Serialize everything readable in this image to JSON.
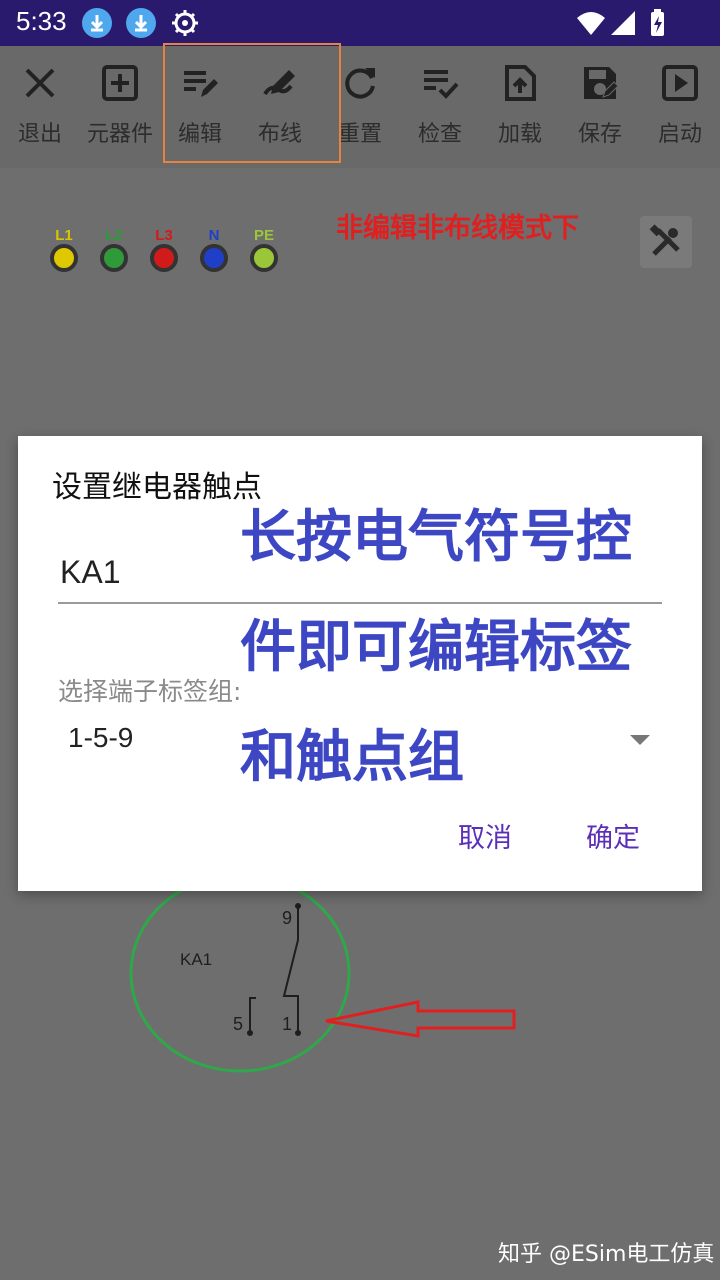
{
  "status_bar": {
    "time": "5:33",
    "icons": [
      "download-icon",
      "download-icon",
      "settings-icon",
      "wifi-icon",
      "signal-icon",
      "battery-charging-icon"
    ]
  },
  "toolbar": {
    "items": [
      {
        "name": "exit",
        "label": "退出",
        "icon": "close-icon"
      },
      {
        "name": "components",
        "label": "元器件",
        "icon": "add-box-icon"
      },
      {
        "name": "edit",
        "label": "编辑",
        "icon": "edit-list-icon"
      },
      {
        "name": "wiring",
        "label": "布线",
        "icon": "pen-draw-icon"
      },
      {
        "name": "reset",
        "label": "重置",
        "icon": "refresh-icon"
      },
      {
        "name": "check",
        "label": "检查",
        "icon": "checklist-icon"
      },
      {
        "name": "load",
        "label": "加载",
        "icon": "file-upload-icon"
      },
      {
        "name": "save",
        "label": "保存",
        "icon": "save-icon"
      },
      {
        "name": "start",
        "label": "启动",
        "icon": "play-box-icon"
      }
    ]
  },
  "terminals": [
    {
      "label": "L1",
      "color": "#e0c800"
    },
    {
      "label": "L2",
      "color": "#2e9a3a"
    },
    {
      "label": "L3",
      "color": "#d11a1a"
    },
    {
      "label": "N",
      "color": "#1f3fc8"
    },
    {
      "label": "PE",
      "color": "#9bc63a"
    }
  ],
  "annotation": {
    "mode_note": "非编辑非布线模式下",
    "overlay_lines": [
      "长按电气符号控",
      "件即可编辑标签",
      "和触点组"
    ]
  },
  "dialog": {
    "title": "设置继电器触点",
    "input_value": "KA1",
    "select_label": "选择端子标签组:",
    "select_value": "1-5-9",
    "cancel_label": "取消",
    "confirm_label": "确定"
  },
  "diagram": {
    "component_label": "KA1",
    "pin_top": "9",
    "pin_left": "5",
    "pin_right": "1"
  },
  "watermark": "知乎 @ESim电工仿真",
  "colors": {
    "status_bar": "#2a1a6e",
    "highlight_box": "#e5843f",
    "dialog_button": "#5b2fb8",
    "overlay_text": "#3d47c4",
    "mode_note": "#e02020",
    "circle": "#2fa84a",
    "arrow": "#e02020"
  }
}
